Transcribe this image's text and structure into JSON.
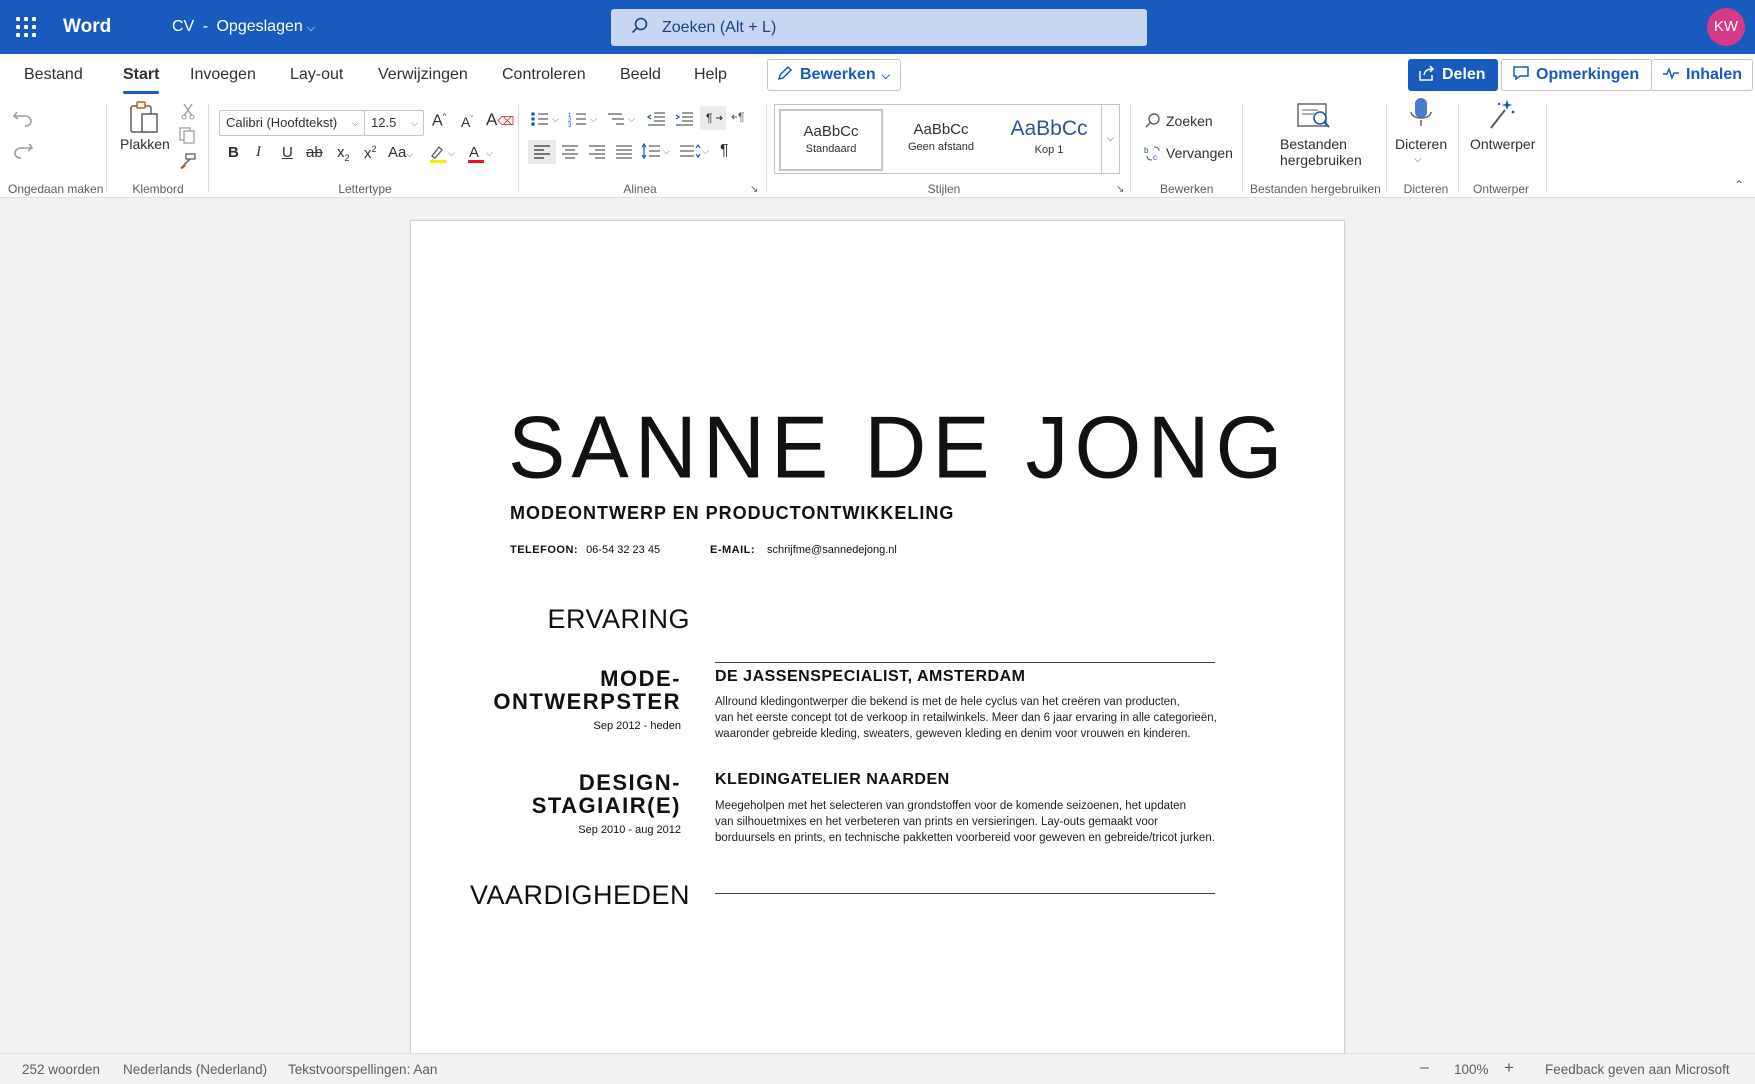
{
  "titlebar": {
    "app_name": "Word",
    "doc_name": "CV",
    "doc_separator": "-",
    "save_status": "Opgeslagen",
    "search_placeholder": "Zoeken (Alt + L)",
    "user_initials": "KW",
    "accent": "#185abd",
    "avatar_color": "#d6388a"
  },
  "menu": {
    "tabs": [
      "Bestand",
      "Start",
      "Invoegen",
      "Lay-out",
      "Verwijzingen",
      "Controleren",
      "Beeld",
      "Help"
    ],
    "active_tab": "Start",
    "edit_mode_label": "Bewerken",
    "share_label": "Delen",
    "comments_label": "Opmerkingen",
    "catchup_label": "Inhalen"
  },
  "ribbon": {
    "groups": {
      "undo": "Ongedaan maken",
      "clipboard": "Klembord",
      "font": "Lettertype",
      "paragraph": "Alinea",
      "styles": "Stijlen",
      "editing": "Bewerken",
      "reuse": "Bestanden hergebruiken",
      "dictate": "Dicteren",
      "designer": "Ontwerper"
    },
    "paste_label": "Plakken",
    "font_name": "Calibri (Hoofdtekst)",
    "font_size": "12.5",
    "change_case_label": "Aa",
    "styles": [
      {
        "sample": "AaBbCc",
        "name": "Standaard"
      },
      {
        "sample": "AaBbCc",
        "name": "Geen afstand"
      },
      {
        "sample": "AaBbCc",
        "name": "Kop 1"
      }
    ],
    "find_label": "Zoeken",
    "replace_label": "Vervangen",
    "reuse_line1": "Bestanden",
    "reuse_line2": "hergebruiken",
    "dictate_label": "Dicteren",
    "designer_label": "Ontwerper"
  },
  "document": {
    "name": "SANNE DE JONG",
    "subtitle": "MODEONTWERP EN PRODUCTONTWIKKELING",
    "phone_label": "TELEFOON:",
    "phone": "06-54 32 23 45",
    "email_label": "E-MAIL:",
    "email": "schrijfme@sannedejong.nl",
    "experience_title": "ERVARING",
    "jobs": [
      {
        "role_line1": "MODE-",
        "role_line2": "ONTWERPSTER",
        "dates": "Sep 2012 - heden",
        "company": "DE JASSENSPECIALIST, AMSTERDAM",
        "desc_line1": "Allround kledingontwerper die bekend is met de hele cyclus van het creëren van producten,",
        "desc_line2": "van het eerste concept tot de verkoop in retailwinkels. Meer dan 6 jaar ervaring in alle categorieën,",
        "desc_line3": "waaronder gebreide kleding, sweaters, geweven kleding en denim voor vrouwen en kinderen."
      },
      {
        "role_line1": "DESIGN-",
        "role_line2": "STAGIAIR(E)",
        "dates": "Sep 2010 - aug 2012",
        "company": "KLEDINGATELIER NAARDEN",
        "desc_line1": "Meegeholpen met het selecteren van grondstoffen voor de komende seizoenen, het updaten",
        "desc_line2": "van silhouetmixes en het verbeteren van prints en versieringen. Lay-outs gemaakt voor",
        "desc_line3": "borduursels en prints, en technische pakketten voorbereid voor geweven en gebreide/tricot jurken."
      }
    ],
    "skills_title": "VAARDIGHEDEN"
  },
  "statusbar": {
    "word_count": "252 woorden",
    "language": "Nederlands (Nederland)",
    "predictions": "Tekstvoorspellingen: Aan",
    "zoom": "100%",
    "feedback": "Feedback geven aan Microsoft"
  }
}
